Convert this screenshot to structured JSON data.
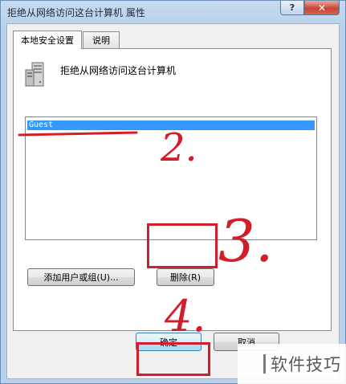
{
  "window": {
    "title": "拒绝从网络访问这台计算机 属性",
    "help_glyph": "?",
    "close_glyph": "✕"
  },
  "tabs": [
    {
      "label": "本地安全设置"
    },
    {
      "label": "说明"
    }
  ],
  "policy": {
    "name": "拒绝从网络访问这台计算机",
    "icon": "server-computer-icon"
  },
  "list": {
    "items": [
      {
        "label": "Guest"
      }
    ]
  },
  "buttons": {
    "add_label": "添加用户或组(U)...",
    "remove_label": "删除(R)",
    "ok_label": "确定",
    "cancel_label": "取消"
  },
  "annotations": {
    "step2": "2.",
    "step3": "3.",
    "step4": "4.",
    "color": "#d21e2a"
  },
  "watermark": {
    "text": "软件技巧"
  }
}
